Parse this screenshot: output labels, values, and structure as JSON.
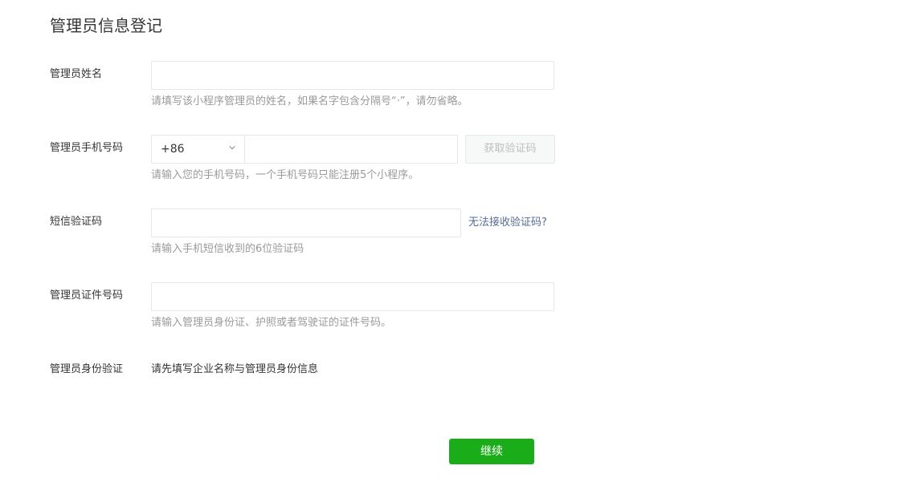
{
  "page": {
    "title": "管理员信息登记"
  },
  "form": {
    "name": {
      "label": "管理员姓名",
      "value": "",
      "hint": "请填写该小程序管理员的姓名，如果名字包含分隔号“·”，请勿省略。"
    },
    "phone": {
      "label": "管理员手机号码",
      "country_code": "+86",
      "value": "",
      "code_button": "获取验证码",
      "hint": "请输入您的手机号码，一个手机号码只能注册5个小程序。"
    },
    "sms": {
      "label": "短信验证码",
      "value": "",
      "help_link": "无法接收验证码?",
      "hint": "请输入手机短信收到的6位验证码"
    },
    "id_number": {
      "label": "管理员证件号码",
      "value": "",
      "hint": "请输入管理员身份证、护照或者驾驶证的证件号码。"
    },
    "identity": {
      "label": "管理员身份验证",
      "value": "请先填写企业名称与管理员身份信息"
    },
    "continue_label": "继续"
  },
  "colors": {
    "primary": "#1aad19",
    "link": "#576b95",
    "hint": "#9a9a9a",
    "border": "#e4e8eb"
  },
  "icons": {
    "country_dropdown": "chevron-down-icon"
  }
}
